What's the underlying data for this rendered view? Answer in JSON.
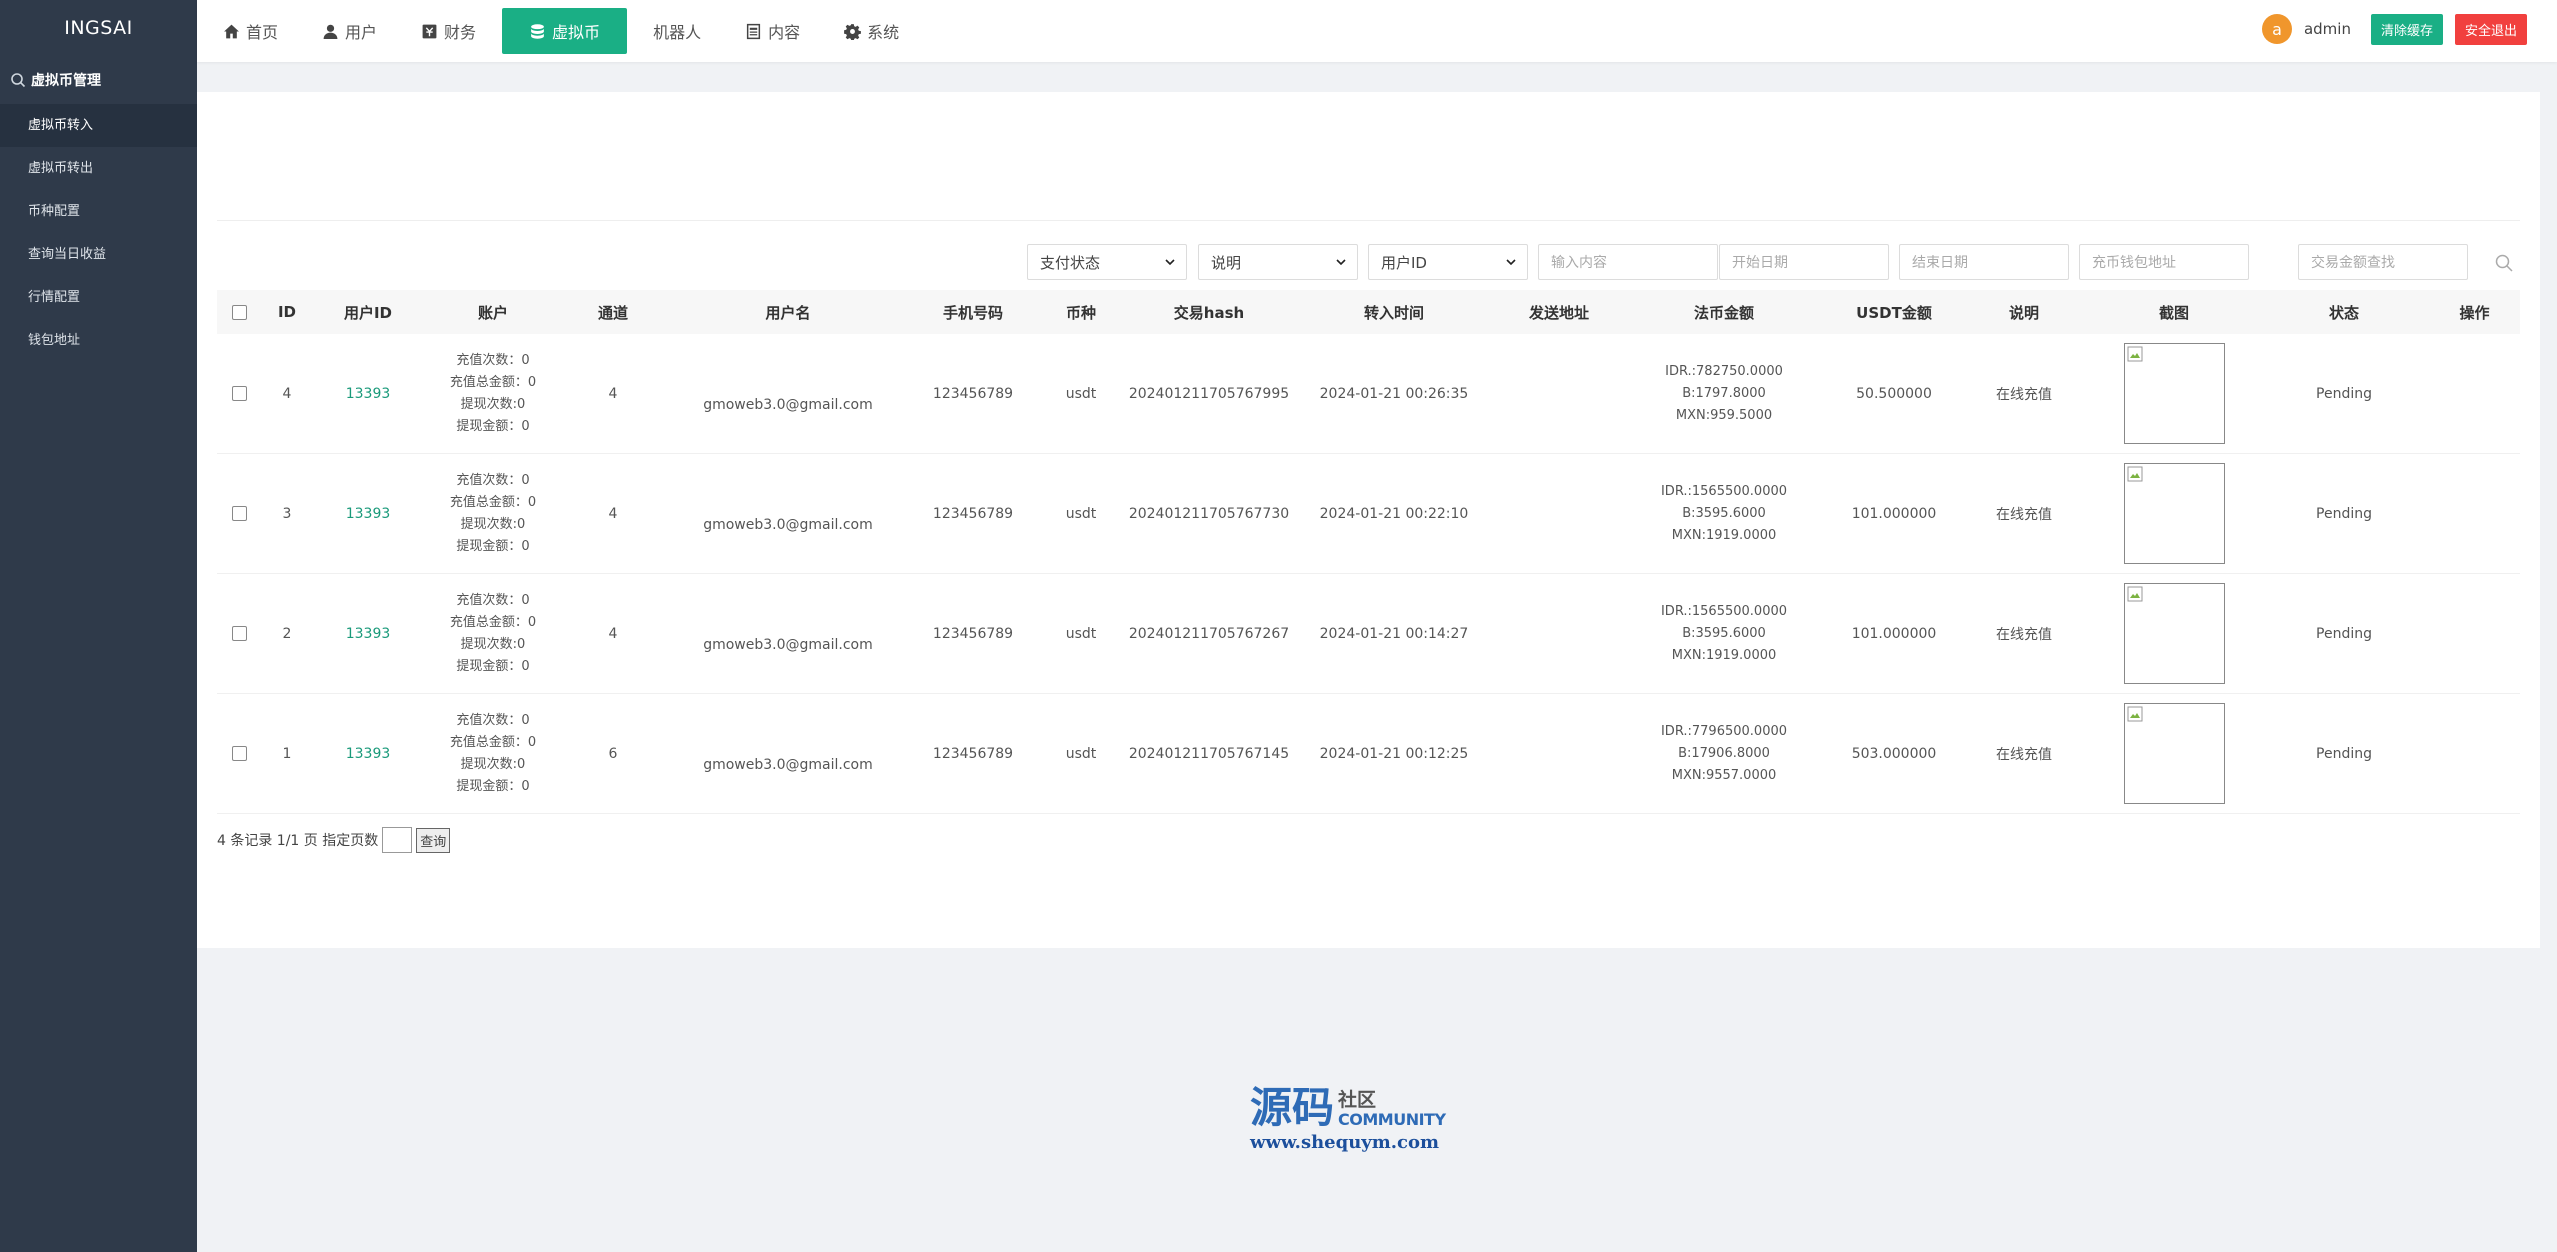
{
  "brand": "INGSAI",
  "sidebar": {
    "group": "虚拟币管理",
    "items": [
      {
        "label": "虚拟币转入",
        "active": true
      },
      {
        "label": "虚拟币转出",
        "active": false
      },
      {
        "label": "币种配置",
        "active": false
      },
      {
        "label": "查询当日收益",
        "active": false
      },
      {
        "label": "行情配置",
        "active": false
      },
      {
        "label": "钱包地址",
        "active": false
      }
    ]
  },
  "nav": [
    {
      "label": "首页",
      "icon": "home-icon"
    },
    {
      "label": "用户",
      "icon": "user-icon"
    },
    {
      "label": "财务",
      "icon": "finance-icon"
    },
    {
      "label": "虚拟币",
      "icon": "database-icon",
      "active": true
    },
    {
      "label": "机器人",
      "icon": ""
    },
    {
      "label": "内容",
      "icon": "document-icon"
    },
    {
      "label": "系统",
      "icon": "gear-icon"
    }
  ],
  "user": {
    "avatar_letter": "a",
    "name": "admin",
    "clear_cache": "清除缓存",
    "logout": "安全退出"
  },
  "filters": {
    "pay_status": "支付状态",
    "remark": "说明",
    "user_id": "用户ID",
    "content_placeholder": "输入内容",
    "start_date_placeholder": "开始日期",
    "end_date_placeholder": "结束日期",
    "wallet_placeholder": "充币钱包地址",
    "amount_placeholder": "交易金额查找"
  },
  "table": {
    "headers": [
      "ID",
      "用户ID",
      "账户",
      "通道",
      "用户名",
      "手机号码",
      "币种",
      "交易hash",
      "转入时间",
      "发送地址",
      "法币金额",
      "USDT金额",
      "说明",
      "截图",
      "状态",
      "操作"
    ],
    "rows": [
      {
        "id": "4",
        "uid": "13393",
        "account": [
          "充值次数：0",
          "充值总金额：0",
          "提现次数:0",
          "提现金额：0"
        ],
        "channel": "4",
        "username": "gmoweb3.0@gmail.com",
        "phone": "123456789",
        "coin": "usdt",
        "hash": "202401211705767995",
        "time": "2024-01-21 00:26:35",
        "send_addr": "",
        "fiat": [
          "IDR.:782750.0000",
          "B:1797.8000",
          "MXN:959.5000"
        ],
        "usdt": "50.500000",
        "remark": "在线充值",
        "status": "Pending"
      },
      {
        "id": "3",
        "uid": "13393",
        "account": [
          "充值次数：0",
          "充值总金额：0",
          "提现次数:0",
          "提现金额：0"
        ],
        "channel": "4",
        "username": "gmoweb3.0@gmail.com",
        "phone": "123456789",
        "coin": "usdt",
        "hash": "202401211705767730",
        "time": "2024-01-21 00:22:10",
        "send_addr": "",
        "fiat": [
          "IDR.:1565500.0000",
          "B:3595.6000",
          "MXN:1919.0000"
        ],
        "usdt": "101.000000",
        "remark": "在线充值",
        "status": "Pending"
      },
      {
        "id": "2",
        "uid": "13393",
        "account": [
          "充值次数：0",
          "充值总金额：0",
          "提现次数:0",
          "提现金额：0"
        ],
        "channel": "4",
        "username": "gmoweb3.0@gmail.com",
        "phone": "123456789",
        "coin": "usdt",
        "hash": "202401211705767267",
        "time": "2024-01-21 00:14:27",
        "send_addr": "",
        "fiat": [
          "IDR.:1565500.0000",
          "B:3595.6000",
          "MXN:1919.0000"
        ],
        "usdt": "101.000000",
        "remark": "在线充值",
        "status": "Pending"
      },
      {
        "id": "1",
        "uid": "13393",
        "account": [
          "充值次数：0",
          "充值总金额：0",
          "提现次数:0",
          "提现金额：0"
        ],
        "channel": "6",
        "username": "gmoweb3.0@gmail.com",
        "phone": "123456789",
        "coin": "usdt",
        "hash": "202401211705767145",
        "time": "2024-01-21 00:12:25",
        "send_addr": "",
        "fiat": [
          "IDR.:7796500.0000",
          "B:17906.8000",
          "MXN:9557.0000"
        ],
        "usdt": "503.000000",
        "remark": "在线充值",
        "status": "Pending"
      }
    ]
  },
  "pager": {
    "summary": "4 条记录 1/1 页 指定页数",
    "go": "查询"
  },
  "watermark": {
    "cn": "源码",
    "cn_small": "社区",
    "en": "COMMUNITY",
    "url": "www.shequym.com"
  }
}
